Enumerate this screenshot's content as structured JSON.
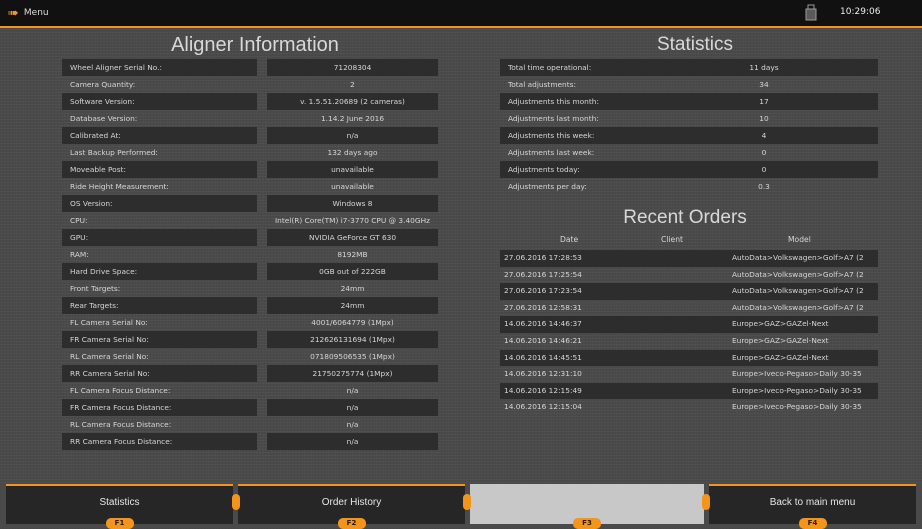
{
  "topbar": {
    "menu_label": "Menu",
    "clock": "10:29:06"
  },
  "aligner": {
    "title": "Aligner Information",
    "rows": [
      {
        "label": "Wheel Aligner Serial No.:",
        "value": "71208304"
      },
      {
        "label": "Camera Quantity:",
        "value": "2"
      },
      {
        "label": "Software Version:",
        "value": "v. 1.5.51.20689 (2 cameras)"
      },
      {
        "label": "Database Version:",
        "value": "1.14.2 June 2016"
      },
      {
        "label": "Calibrated At:",
        "value": "n/a"
      },
      {
        "label": "Last Backup Performed:",
        "value": "132 days ago"
      },
      {
        "label": "Moveable Post:",
        "value": "unavailable"
      },
      {
        "label": "Ride Height Measurement:",
        "value": "unavailable"
      },
      {
        "label": "OS Version:",
        "value": "Windows 8"
      },
      {
        "label": "CPU:",
        "value": "Intel(R) Core(TM) i7-3770 CPU @ 3.40GHz"
      },
      {
        "label": "GPU:",
        "value": "NVIDIA GeForce GT 630"
      },
      {
        "label": "RAM:",
        "value": "8192MB"
      },
      {
        "label": "Hard Drive Space:",
        "value": "0GB out of 222GB"
      },
      {
        "label": "Front Targets:",
        "value": "24mm"
      },
      {
        "label": "Rear Targets:",
        "value": "24mm"
      },
      {
        "label": "FL Camera Serial No:",
        "value": "4001/6064779 (1Mpx)"
      },
      {
        "label": "FR Camera Serial No:",
        "value": "212626131694 (1Mpx)"
      },
      {
        "label": "RL Camera Serial No:",
        "value": "071809506535 (1Mpx)"
      },
      {
        "label": "RR Camera Serial No:",
        "value": "21750275774 (1Mpx)"
      },
      {
        "label": "FL Camera Focus Distance:",
        "value": "n/a"
      },
      {
        "label": "FR Camera Focus Distance:",
        "value": "n/a"
      },
      {
        "label": "RL Camera Focus Distance:",
        "value": "n/a"
      },
      {
        "label": "RR Camera Focus Distance:",
        "value": "n/a"
      }
    ]
  },
  "statistics": {
    "title": "Statistics",
    "rows": [
      {
        "label": "Total time operational:",
        "value": "11 days"
      },
      {
        "label": "Total adjustments:",
        "value": "34"
      },
      {
        "label": "Adjustments this month:",
        "value": "17"
      },
      {
        "label": "Adjustments last month:",
        "value": "10"
      },
      {
        "label": "Adjustments this week:",
        "value": "4"
      },
      {
        "label": "Adjustments last week:",
        "value": "0"
      },
      {
        "label": "Adjustments today:",
        "value": "0"
      },
      {
        "label": "Adjustments per day:",
        "value": "0.3"
      }
    ]
  },
  "recent_orders": {
    "title": "Recent Orders",
    "columns": {
      "date": "Date",
      "client": "Client",
      "model": "Model"
    },
    "rows": [
      {
        "date": "27.06.2016 17:28:53",
        "client": "",
        "model": "AutoData>Volkswagen>Golf>A7 (2"
      },
      {
        "date": "27.06.2016 17:25:54",
        "client": "",
        "model": "AutoData>Volkswagen>Golf>A7 (2"
      },
      {
        "date": "27.06.2016 17:23:54",
        "client": "",
        "model": "AutoData>Volkswagen>Golf>A7 (2"
      },
      {
        "date": "27.06.2016 12:58:31",
        "client": "",
        "model": "AutoData>Volkswagen>Golf>A7 (2"
      },
      {
        "date": "14.06.2016 14:46:37",
        "client": "",
        "model": "Europe>GAZ>GAZel-Next"
      },
      {
        "date": "14.06.2016 14:46:21",
        "client": "",
        "model": "Europe>GAZ>GAZel-Next"
      },
      {
        "date": "14.06.2016 14:45:51",
        "client": "",
        "model": "Europe>GAZ>GAZel-Next"
      },
      {
        "date": "14.06.2016 12:31:10",
        "client": "",
        "model": "Europe>Iveco-Pegaso>Daily 30-35"
      },
      {
        "date": "14.06.2016 12:15:49",
        "client": "",
        "model": "Europe>Iveco-Pegaso>Daily 30-35"
      },
      {
        "date": "14.06.2016 12:15:04",
        "client": "",
        "model": "Europe>Iveco-Pegaso>Daily 30-35"
      }
    ]
  },
  "fkeys": [
    {
      "label": "Statistics",
      "key": "F1",
      "enabled": true
    },
    {
      "label": "Order History",
      "key": "F2",
      "enabled": true
    },
    {
      "label": "",
      "key": "F3",
      "enabled": false
    },
    {
      "label": "Back to main menu",
      "key": "F4",
      "enabled": true
    }
  ],
  "colors": {
    "accent": "#f3951b",
    "background": "#4a4a4a",
    "row_bar": "#2d2d2d",
    "topbar": "#111111"
  }
}
